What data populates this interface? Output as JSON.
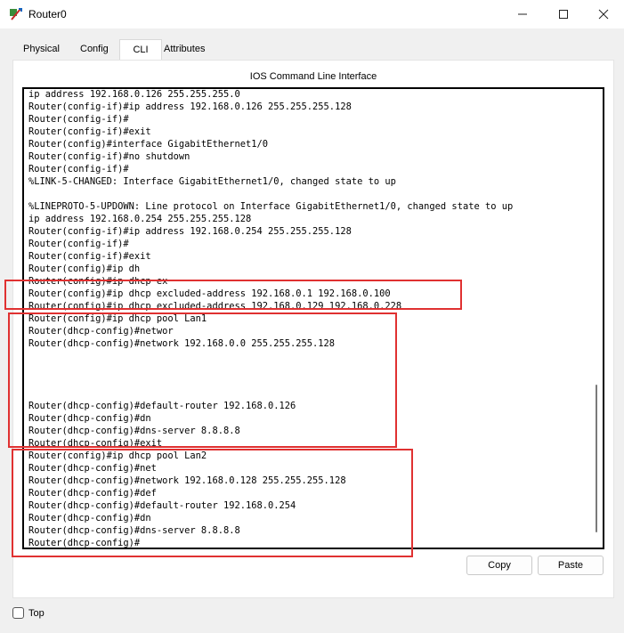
{
  "window": {
    "title": "Router0",
    "controls": {
      "minimize": "—",
      "maximize": "☐",
      "close": "✕"
    }
  },
  "tabs": [
    {
      "label": "Physical",
      "active": false
    },
    {
      "label": "Config",
      "active": false
    },
    {
      "label": "CLI",
      "active": true
    },
    {
      "label": "Attributes",
      "active": false
    }
  ],
  "panel": {
    "title": "IOS Command Line Interface"
  },
  "terminal": {
    "lines": [
      "ip address 192.168.0.126 255.255.255.0",
      "Router(config-if)#ip address 192.168.0.126 255.255.255.128",
      "Router(config-if)#",
      "Router(config-if)#exit",
      "Router(config)#interface GigabitEthernet1/0",
      "Router(config-if)#no shutdown",
      "Router(config-if)#",
      "%LINK-5-CHANGED: Interface GigabitEthernet1/0, changed state to up",
      "",
      "%LINEPROTO-5-UPDOWN: Line protocol on Interface GigabitEthernet1/0, changed state to up",
      "ip address 192.168.0.254 255.255.255.128",
      "Router(config-if)#ip address 192.168.0.254 255.255.255.128",
      "Router(config-if)#",
      "Router(config-if)#exit",
      "Router(config)#ip dh",
      "Router(config)#ip dhcp ex",
      "Router(config)#ip dhcp excluded-address 192.168.0.1 192.168.0.100",
      "Router(config)#ip dhcp excluded-address 192.168.0.129 192.168.0.228",
      "Router(config)#ip dhcp pool Lan1",
      "Router(dhcp-config)#networ",
      "Router(dhcp-config)#network 192.168.0.0 255.255.255.128",
      "",
      "",
      "",
      "",
      "Router(dhcp-config)#default-router 192.168.0.126",
      "Router(dhcp-config)#dn",
      "Router(dhcp-config)#dns-server 8.8.8.8",
      "Router(dhcp-config)#exit",
      "Router(config)#ip dhcp pool Lan2",
      "Router(dhcp-config)#net",
      "Router(dhcp-config)#network 192.168.0.128 255.255.255.128",
      "Router(dhcp-config)#def",
      "Router(dhcp-config)#default-router 192.168.0.254",
      "Router(dhcp-config)#dn",
      "Router(dhcp-config)#dns-server 8.8.8.8",
      "Router(dhcp-config)#"
    ]
  },
  "buttons": {
    "copy": "Copy",
    "paste": "Paste"
  },
  "footer": {
    "top_label": "Top",
    "top_checked": false
  },
  "colors": {
    "highlight": "#e03131",
    "tab_accent": "#1c5fb4"
  }
}
